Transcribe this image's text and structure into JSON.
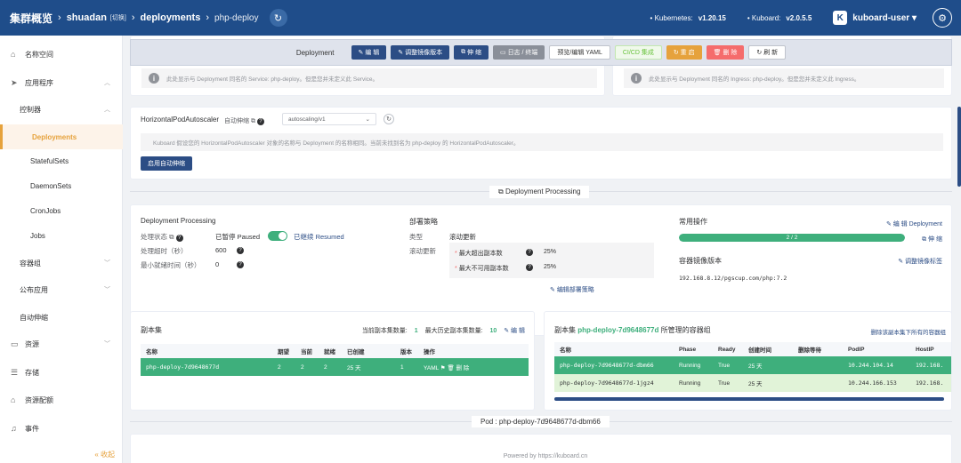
{
  "header": {
    "title": "集群概览",
    "cluster": "shuadan",
    "switch_label": "[切换]",
    "section": "deployments",
    "page": "php-deploy",
    "kubernetes_label": "Kubernetes:",
    "kubernetes_version": "v1.20.15",
    "kuboard_label": "Kuboard:",
    "kuboard_version": "v2.0.5.5",
    "avatar_letter": "K",
    "user": "kuboard-user"
  },
  "sidebar": {
    "items": [
      {
        "label": "名称空间"
      },
      {
        "label": "应用程序"
      },
      {
        "label": "控制器"
      },
      {
        "label": "Deployments"
      },
      {
        "label": "StatefulSets"
      },
      {
        "label": "DaemonSets"
      },
      {
        "label": "CronJobs"
      },
      {
        "label": "Jobs"
      },
      {
        "label": "容器组"
      },
      {
        "label": "公布应用"
      },
      {
        "label": "自动伸缩"
      },
      {
        "label": "资源"
      },
      {
        "label": "存储"
      },
      {
        "label": "资源配额"
      },
      {
        "label": "事件"
      }
    ],
    "collapse_label": "« 收起"
  },
  "toolbar": {
    "label": "Deployment",
    "edit": "编 辑",
    "adjust_image": "调整镜像版本",
    "scale": "伸 缩",
    "logs": "日志 / 终端",
    "preview_yaml": "预览/编辑 YAML",
    "cicd": "CI/CD 集成",
    "restart": "重 启",
    "delete": "删 除",
    "refresh": "刷 新"
  },
  "service_info": "此处显示与 Deployment 同名的 Service: php-deploy。但是您并未定义此 Service。",
  "ingress_info": "此处显示与 Deployment 同名的 Ingress: php-deploy。但是您并未定义此 Ingress。",
  "hpa": {
    "title": "HorizontalPodAutoscaler",
    "auto_scale_label": "自动伸缩",
    "version": "autoscaling/v1",
    "info": "Kuboard 假设您的 HorizontalPodAutoscaler 对象的名称与 Deployment 的名称相同。当前未找到名为 php-deploy 的 HorizontalPodAutoscaler。",
    "enable_button": "启用自动伸缩"
  },
  "processing_divider": "Deployment Processing",
  "processing": {
    "title": "Deployment Processing",
    "status_label": "处理状态",
    "status_paused": "已暂停 Paused",
    "status_resumed": "已继续 Resumed",
    "timeout_label": "处理超时（秒）",
    "timeout_value": "600",
    "min_ready_label": "最小就绪时间（秒）",
    "min_ready_value": "0"
  },
  "strategy": {
    "title": "部署策略",
    "type_label": "类型",
    "type_value": "滚动更新",
    "rolling_label": "滚动更新",
    "max_surge_label": "最大超出副本数",
    "max_surge_value": "25%",
    "max_unavailable_label": "最大不可用副本数",
    "max_unavailable_value": "25%",
    "edit_link": "编辑部署策略"
  },
  "common_ops": {
    "title": "常用操作",
    "edit_link": "编 辑 Deployment",
    "progress_text": "2 / 2",
    "progress_ratio": 1.0,
    "scale_link": "伸 缩",
    "image_title": "容器镜像版本",
    "image_link": "调整镜像标签",
    "image_value": "192.168.8.12/pgscup.com/php:7.2"
  },
  "replicasets": {
    "title": "副本集",
    "current_label": "当前副本集数量:",
    "current_value": "1",
    "history_label": "最大历史副本集数量:",
    "history_value": "10",
    "edit_label": "编 辑",
    "columns": [
      "名称",
      "期望",
      "当前",
      "就绪",
      "已创建",
      "版本",
      "操作"
    ],
    "rows": [
      {
        "name": "php-deploy-7d9648677d",
        "desired": "2",
        "current": "2",
        "ready": "2",
        "age": "25 天",
        "version": "1",
        "yaml": "YAML",
        "delete": "删 除"
      }
    ]
  },
  "pods": {
    "title_prefix": "副本集",
    "title_name": "php-deploy-7d9648677d",
    "title_suffix": "所管理的容器组",
    "delete_all": "删除该副本集下所有的容器组",
    "columns": [
      "名称",
      "Phase",
      "Ready",
      "创建时间",
      "删除等待",
      "PodIP",
      "HostIP"
    ],
    "rows": [
      {
        "name": "php-deploy-7d9648677d-dbm66",
        "phase": "Running",
        "ready": "True",
        "age": "25 天",
        "wait": "",
        "pod_ip": "10.244.104.14",
        "host_ip": "192.168."
      },
      {
        "name": "php-deploy-7d9648677d-1jgz4",
        "phase": "Running",
        "ready": "True",
        "age": "25 天",
        "wait": "",
        "pod_ip": "10.244.166.153",
        "host_ip": "192.168."
      }
    ]
  },
  "pod_divider": "Pod : php-deploy-7d9648677d-dbm66",
  "footer": "Powered by https://kuboard.cn",
  "colors": {
    "header": "#1f4d8a",
    "accent": "#e6a23c",
    "success": "#3eaf7c"
  }
}
